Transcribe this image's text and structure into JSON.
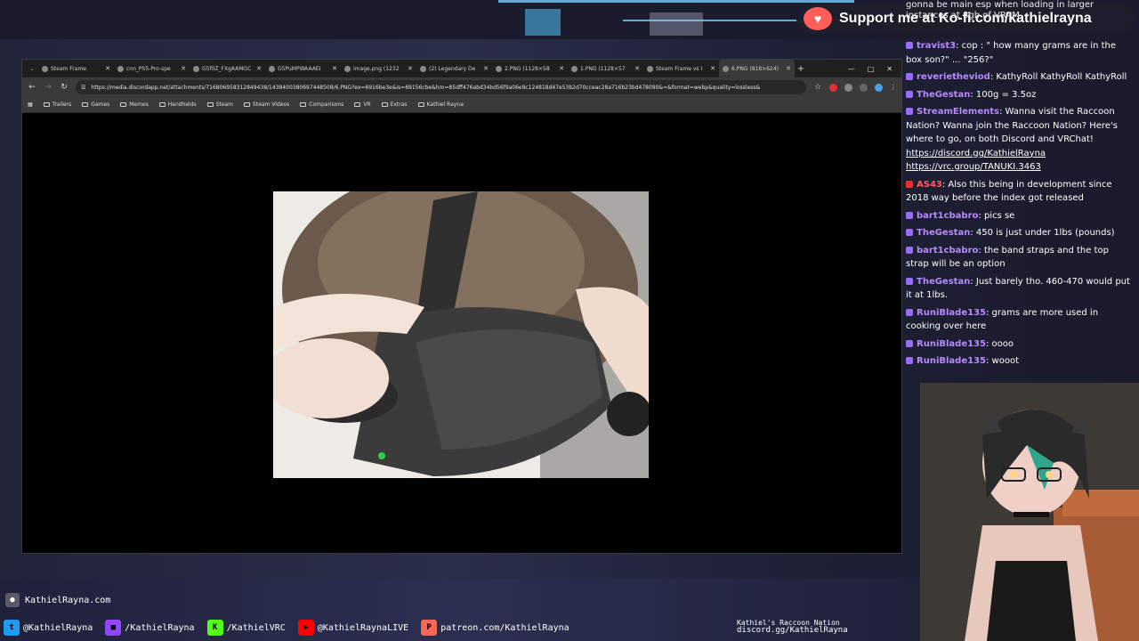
{
  "colors": {
    "accent_cyan": "#6fd0ff",
    "kofi_red": "#ff5e5b",
    "chat_username": "#b58bff",
    "youtube_red": "#ff2b2b"
  },
  "browser": {
    "tabs": [
      {
        "title": "Steam Frame",
        "active": false
      },
      {
        "title": "cnn_PS5-Pro-spe",
        "active": false
      },
      {
        "title": "G5f0Z_FXgAAMGC",
        "active": false
      },
      {
        "title": "G5PuMPWAAAEI",
        "active": false
      },
      {
        "title": "image.png (1232",
        "active": false
      },
      {
        "title": "(2) Legendary De",
        "active": false
      },
      {
        "title": "2.PNG (1128×58",
        "active": false
      },
      {
        "title": "1.PNG (1128×57",
        "active": false
      },
      {
        "title": "Steam Frame vs I",
        "active": false
      },
      {
        "title": "6.PNG (818×624)",
        "active": true
      }
    ],
    "url": "https://media.discordapp.net/attachments/716806958312849438/1438400380697448508/6.PNG?ex=6916be3e&is=69156cbe&hm=85dff476abd34bd56f9a06e9c124818d47e53b2d70cceac28a716b23bd478090&=&format=webp&quality=lossless&",
    "bookmarks": [
      "Trailers",
      "Games",
      "Memes",
      "Handhelds",
      "Steam",
      "Steam Videos",
      "Comparisons",
      "VR",
      "Extras",
      "Kathiel Rayna"
    ]
  },
  "kofi": {
    "label": "Support me at Ko-fi.com/kathielrayna"
  },
  "chat": {
    "top_lines": [
      "gonna be main esp when loading in larger",
      "instances at 8gb of VRAM"
    ],
    "messages": [
      {
        "user": "travist3",
        "text": "cop : \" how many grams are in the box son?\" ... \"256?\"",
        "yt": false
      },
      {
        "user": "reverietheviod",
        "text": "KathyRoll KathyRoll KathyRoll",
        "yt": false
      },
      {
        "user": "TheGestan",
        "text": "100g = 3.5oz",
        "yt": false
      },
      {
        "user": "StreamElements",
        "text": "Wanna visit the Raccoon Nation? Wanna join the Raccoon Nation? Here's where to go, on both Discord and VRChat!",
        "link1": "https://discord.gg/KathielRayna",
        "link2": "https://vrc.group/TANUKI.3463",
        "yt": false
      },
      {
        "user": "AS43",
        "text": "Also this being in development since 2018 way before the index got released",
        "yt": true
      },
      {
        "user": "bart1cbabro",
        "text": "pics se",
        "yt": false
      },
      {
        "user": "TheGestan",
        "text": "450 is just under 1lbs (pounds)",
        "yt": false
      },
      {
        "user": "bart1cbabro",
        "text": "the band straps and the top strap will be an option",
        "yt": false
      },
      {
        "user": "TheGestan",
        "text": "Just barely tho. 460-470 would put it at 1lbs.",
        "yt": false
      },
      {
        "user": "RuniBlade135",
        "text": "grams are more used in cooking over here",
        "yt": false
      },
      {
        "user": "RuniBlade135",
        "text": "oooo",
        "yt": false
      },
      {
        "user": "RuniBlade135",
        "text": "wooot",
        "yt": false
      }
    ]
  },
  "footer": {
    "website": "KathielRayna.com",
    "socials": [
      {
        "icon": "twitter-bird-icon",
        "label": "@KathielRayna",
        "color": "#1d9bf0",
        "glyph": "t"
      },
      {
        "icon": "twitch-icon",
        "label": "/KathielRayna",
        "color": "#9146ff",
        "glyph": "■"
      },
      {
        "icon": "kick-icon",
        "label": "/KathielVRC",
        "color": "#53fc18",
        "glyph": "K"
      },
      {
        "icon": "youtube-icon",
        "label": "@KathielRaynaLIVE",
        "color": "#ff0000",
        "glyph": "▶"
      },
      {
        "icon": "patreon-icon",
        "label": "patreon.com/KathielRayna",
        "color": "#f96854",
        "glyph": "P"
      }
    ],
    "raccoon_title": "Kathiel's Raccoon Nation",
    "discord": "discord.gg/KathielRayna"
  }
}
